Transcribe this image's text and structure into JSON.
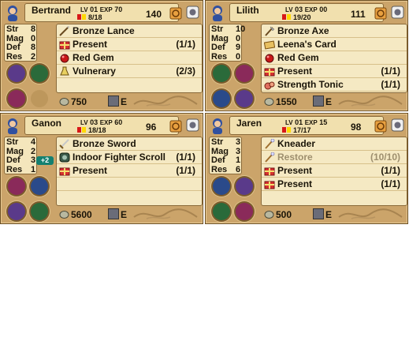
{
  "units": [
    {
      "name": "Bertrand",
      "lv_label": "LV",
      "lv": "01",
      "exp_label": "EXP",
      "exp": "70",
      "hp": "8/18",
      "move": "140",
      "stats": [
        {
          "label": "Str",
          "value": "8"
        },
        {
          "label": "Mag",
          "value": "0"
        },
        {
          "label": "Def",
          "value": "8"
        },
        {
          "label": "Res",
          "value": "2"
        }
      ],
      "items": [
        {
          "icon": "lance-icon",
          "name": "Bronze Lance",
          "uses": ""
        },
        {
          "icon": "present-icon",
          "name": "Present",
          "uses": "(1/1)"
        },
        {
          "icon": "red-gem-icon",
          "name": "Red Gem",
          "uses": ""
        },
        {
          "icon": "vulnerary-icon",
          "name": "Vulnerary",
          "uses": "(2/3)"
        }
      ],
      "gold": "750",
      "weapon_rank": "E"
    },
    {
      "name": "Lilith",
      "lv_label": "LV",
      "lv": "03",
      "exp_label": "EXP",
      "exp": "00",
      "hp": "19/20",
      "move": "111",
      "stats": [
        {
          "label": "Str",
          "value": "10"
        },
        {
          "label": "Mag",
          "value": "0"
        },
        {
          "label": "Def",
          "value": "9"
        },
        {
          "label": "Res",
          "value": "0"
        }
      ],
      "items": [
        {
          "icon": "axe-icon",
          "name": "Bronze Axe",
          "uses": ""
        },
        {
          "icon": "card-icon",
          "name": "Leena's Card",
          "uses": ""
        },
        {
          "icon": "red-gem-icon",
          "name": "Red Gem",
          "uses": ""
        },
        {
          "icon": "present-icon",
          "name": "Present",
          "uses": "(1/1)"
        },
        {
          "icon": "tonic-icon",
          "name": "Strength Tonic",
          "uses": "(1/1)"
        }
      ],
      "gold": "1550",
      "weapon_rank": "E"
    },
    {
      "name": "Ganon",
      "lv_label": "LV",
      "lv": "03",
      "exp_label": "EXP",
      "exp": "60",
      "hp": "18/18",
      "move": "96",
      "stats": [
        {
          "label": "Str",
          "value": "4"
        },
        {
          "label": "Mag",
          "value": "2"
        },
        {
          "label": "Def",
          "value": "3"
        },
        {
          "label": "Res",
          "value": "1"
        }
      ],
      "def_bonus": "+2",
      "items": [
        {
          "icon": "sword-icon",
          "name": "Bronze Sword",
          "uses": ""
        },
        {
          "icon": "scroll-icon",
          "name": "Indoor Fighter Scroll",
          "uses": "(1/1)"
        },
        {
          "icon": "present-icon",
          "name": "Present",
          "uses": "(1/1)"
        }
      ],
      "gold": "5600",
      "weapon_rank": "E"
    },
    {
      "name": "Jaren",
      "lv_label": "LV",
      "lv": "01",
      "exp_label": "EXP",
      "exp": "15",
      "hp": "17/17",
      "move": "98",
      "stats": [
        {
          "label": "Str",
          "value": "3"
        },
        {
          "label": "Mag",
          "value": "3"
        },
        {
          "label": "Def",
          "value": "1"
        },
        {
          "label": "Res",
          "value": "6"
        }
      ],
      "items": [
        {
          "icon": "staff-icon",
          "name": "Kneader",
          "uses": ""
        },
        {
          "icon": "staff-icon",
          "name": "Restore",
          "uses": "(10/10)",
          "dim": true
        },
        {
          "icon": "present-icon",
          "name": "Present",
          "uses": "(1/1)"
        },
        {
          "icon": "present-icon",
          "name": "Present",
          "uses": "(1/1)"
        }
      ],
      "gold": "500",
      "weapon_rank": "E"
    }
  ],
  "colors": {
    "panel": "#cba46a",
    "header": "#f1e0ae",
    "hp_red": "#d81818",
    "hp_yellow": "#ffd800",
    "bonus": "#138070"
  }
}
